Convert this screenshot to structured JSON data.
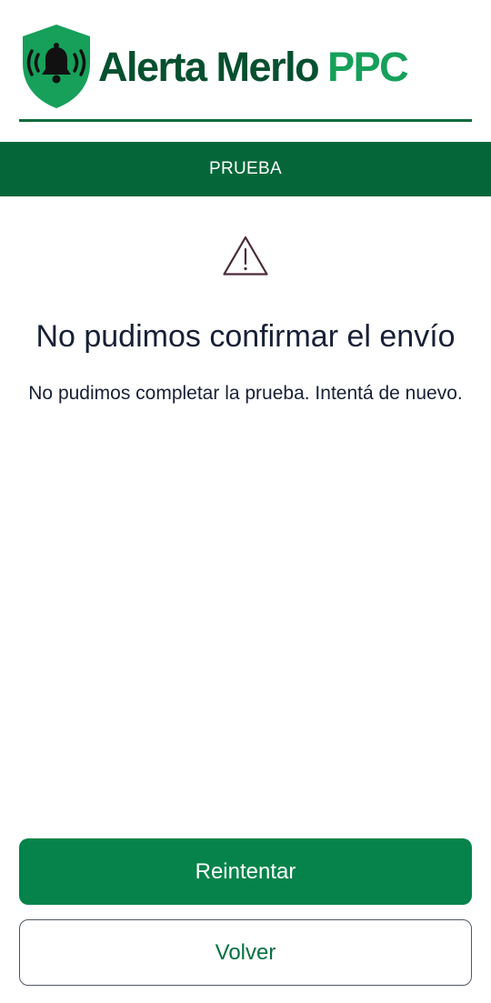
{
  "header": {
    "brand_name": "Alerta Merlo",
    "brand_suffix": "PPC",
    "logo_icon": "bell-shield-icon"
  },
  "section": {
    "title": "PRUEBA"
  },
  "status": {
    "icon": "warning-icon",
    "title": "No pudimos confirmar el envío",
    "message": "No pudimos completar la prueba. Intentá de nuevo."
  },
  "actions": {
    "retry_label": "Reintentar",
    "back_label": "Volver"
  },
  "colors": {
    "brand_dark": "#06502f",
    "brand_light": "#16a05a",
    "bar": "#056739",
    "primary_button": "#05834a",
    "text": "#172036",
    "warning_stroke": "#4a2a3a"
  }
}
